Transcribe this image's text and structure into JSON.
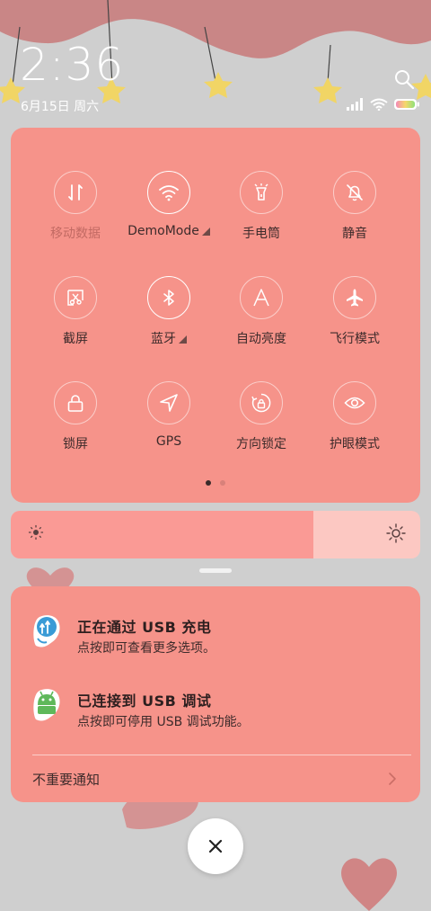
{
  "status_bar": {
    "time": "2:36",
    "date": "6月15日 周六",
    "icons": [
      "signal-icon",
      "wifi-icon",
      "battery-icon"
    ]
  },
  "quick_settings": {
    "tiles": [
      {
        "label": "移动数据",
        "icon": "mobile-data-icon",
        "active": false,
        "disabled": true
      },
      {
        "label": "DemoMode",
        "icon": "wifi-icon",
        "active": true,
        "expandable": true
      },
      {
        "label": "手电筒",
        "icon": "flashlight-icon",
        "active": false
      },
      {
        "label": "静音",
        "icon": "bell-off-icon",
        "active": false
      },
      {
        "label": "截屏",
        "icon": "screenshot-icon",
        "active": false
      },
      {
        "label": "蓝牙",
        "icon": "bluetooth-icon",
        "active": true,
        "expandable": true
      },
      {
        "label": "自动亮度",
        "icon": "auto-brightness-icon",
        "active": false
      },
      {
        "label": "飞行模式",
        "icon": "airplane-icon",
        "active": false
      },
      {
        "label": "锁屏",
        "icon": "lock-icon",
        "active": false
      },
      {
        "label": "GPS",
        "icon": "location-arrow-icon",
        "active": false
      },
      {
        "label": "方向锁定",
        "icon": "rotation-lock-icon",
        "active": false
      },
      {
        "label": "护眼模式",
        "icon": "eye-icon",
        "active": false
      }
    ],
    "page_count": 2,
    "current_page": 1
  },
  "brightness": {
    "level": 0.74
  },
  "notifications": [
    {
      "title": "正在通过 USB 充电",
      "subtitle": "点按即可查看更多选项。",
      "icon": "usb-charging-icon"
    },
    {
      "title": "已连接到 USB 调试",
      "subtitle": "点按即可停用 USB 调试功能。",
      "icon": "android-debug-icon"
    }
  ],
  "unimportant_label": "不重要通知",
  "colors": {
    "panel": "#f6938a",
    "background": "#cfcfcf",
    "brightness_fill": "#fa9a95",
    "brightness_track": "#fcc8c2"
  }
}
